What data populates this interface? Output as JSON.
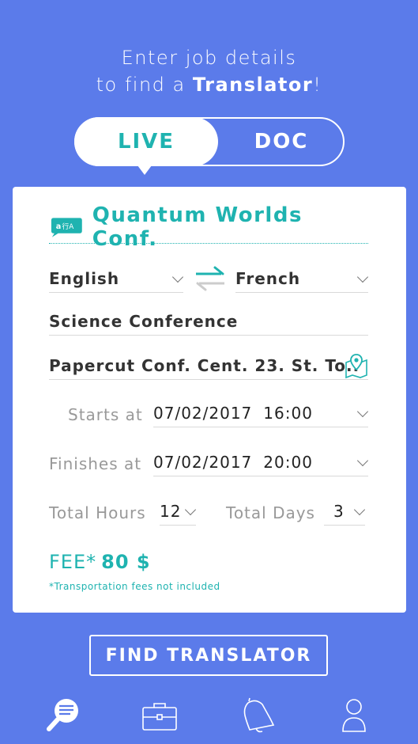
{
  "header": {
    "line1": "Enter job details",
    "line2_prefix": "to find a ",
    "line2_bold": "Translator",
    "line2_suffix": "!"
  },
  "tabs": {
    "live": "LIVE",
    "doc": "DOC",
    "active": "LIVE"
  },
  "form": {
    "job_name": "Quantum Worlds Conf.",
    "source_language": "English",
    "target_language": "French",
    "category": "Science Conference",
    "location": "Papercut Conf. Cent. 23. St. To..",
    "starts_label": "Starts at",
    "starts_date": "07/02/2017",
    "starts_time": "16:00",
    "finishes_label": "Finishes at",
    "finishes_date": "07/02/2017",
    "finishes_time": "20:00",
    "total_hours_label": "Total Hours",
    "total_hours_value": "12",
    "total_days_label": "Total Days",
    "total_days_value": "3",
    "fee_label": "FEE*",
    "fee_value": "80 $",
    "fee_note": "*Transportation fees not included"
  },
  "find_button": "FIND TRANSLATOR",
  "nav": [
    "search-icon",
    "briefcase-icon",
    "bell-icon",
    "profile-icon"
  ],
  "colors": {
    "background": "#5b7bea",
    "accent": "#1fb3b0",
    "white": "#ffffff"
  }
}
